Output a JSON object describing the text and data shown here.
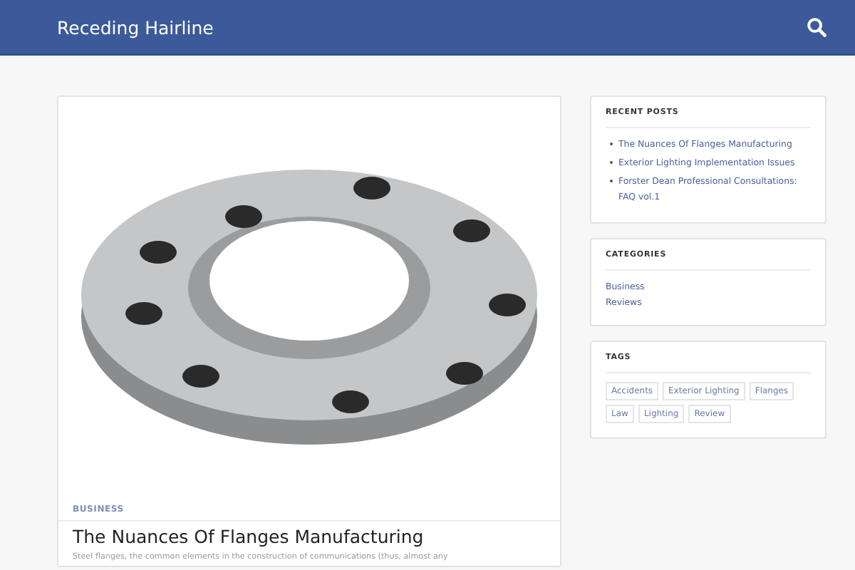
{
  "header": {
    "site_title": "Receding Hairline"
  },
  "post": {
    "category": "BUSINESS",
    "title": "The Nuances Of Flanges Manufacturing",
    "excerpt": "Steel flanges, the common elements in the construction of communications (thus, almost any"
  },
  "recent_posts": {
    "title": "RECENT POSTS",
    "items": [
      "The Nuances Of Flanges Manufacturing",
      "Exterior Lighting Implementation Issues",
      "Forster Dean Professional Consultations: FAQ vol.1"
    ]
  },
  "categories": {
    "title": "CATEGORIES",
    "items": [
      "Business",
      "Reviews"
    ]
  },
  "tags": {
    "title": "TAGS",
    "items": [
      "Accidents",
      "Exterior Lighting",
      "Flanges",
      "Law",
      "Lighting",
      "Review"
    ]
  }
}
